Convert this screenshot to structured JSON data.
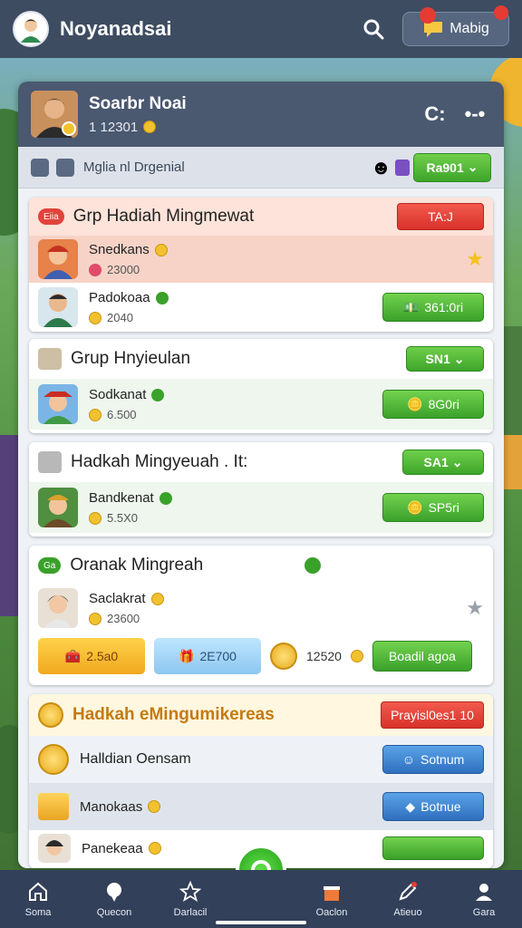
{
  "topbar": {
    "title": "Noyanadsai",
    "button_label": "Mabig",
    "icons": [
      "avatar",
      "search-icon",
      "chat-icon"
    ]
  },
  "panel": {
    "name": "Soarbr Noai",
    "coins": "1 12301",
    "right_icon": "C:",
    "more_icon": "•-•"
  },
  "filterbar": {
    "label": "Mglia nl Drgenial",
    "button": "Ra901"
  },
  "cards": [
    {
      "title": "Grp Hadiah Mingmewat",
      "tag": "Eiia",
      "header_button": "TA:J",
      "rows": [
        {
          "name": "Snedkans",
          "sub": "23000"
        },
        {
          "name": "Padokoaa",
          "sub": "2040",
          "button": "361:0ri"
        }
      ]
    },
    {
      "title": "Grup Hnyieulan",
      "header_button": "SN1",
      "rows": [
        {
          "name": "Sodkanat",
          "sub": "6.500",
          "button": "8G0ri"
        }
      ]
    },
    {
      "title": "Hadkah Mingyeuah . It:",
      "header_button": "SA1",
      "rows": [
        {
          "name": "Bandkenat",
          "sub": "5.5X0",
          "button": "SP5ri"
        }
      ]
    },
    {
      "title": "Oranak Mingreah",
      "tag": "Ga",
      "rows": [
        {
          "name": "Saclakrat",
          "sub": "23600"
        }
      ],
      "rewards": [
        "2.5a0",
        "2E700",
        "12520"
      ],
      "action": "Boadil agoa"
    },
    {
      "title": "Hadkah eMingumikereas",
      "header_button": "Prayisl0es1 10",
      "rows": [
        {
          "name": "Halldian Oensam",
          "button": "Sotnum"
        },
        {
          "name": "Manokaas",
          "button": "Botnue"
        },
        {
          "name": "Panekeaa"
        }
      ]
    }
  ],
  "bottomnav": [
    {
      "label": "Soma",
      "icon": "home-icon"
    },
    {
      "label": "Quecon",
      "icon": "chat-bubble-icon"
    },
    {
      "label": "Darlacil",
      "icon": "star-icon"
    },
    {
      "label": "Oaclon",
      "icon": "gift-icon"
    },
    {
      "label": "Atieuo",
      "icon": "edit-icon"
    },
    {
      "label": "Gara",
      "icon": "profile-icon"
    }
  ],
  "colors": {
    "topbar": "#3e4c62",
    "panel_head": "#4a5870",
    "green": "#3ea52b",
    "red": "#d8322a",
    "blue": "#2f6fbe",
    "first_card_row": "#f7d3c7"
  }
}
